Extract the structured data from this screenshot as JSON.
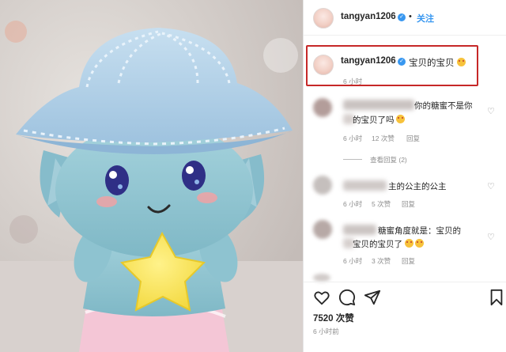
{
  "post": {
    "username": "tangyan1206",
    "verified_glyph": "✓",
    "separator": "•",
    "follow_label": "关注",
    "caption": "宝贝的宝贝",
    "caption_time": "6 小时",
    "likes": "7520 次赞",
    "post_time": "6 小时前"
  },
  "comments": [
    {
      "text_line1": "你的糖蜜不是你",
      "text_line2": "的宝贝了吗",
      "time": "6 小时",
      "likes": "12 次赞",
      "reply": "回复"
    },
    {
      "text_line1": "主的公主的公主",
      "time": "6 小时",
      "likes": "5 次赞",
      "reply": "回复"
    },
    {
      "text_line1": "糖蜜角度就是：宝贝的",
      "text_line2": "宝贝的宝贝了",
      "time": "6 小时",
      "likes": "3 次赞",
      "reply": "回复"
    }
  ],
  "view_replies": "查看回复 (2)",
  "icons": {
    "heart": "heart-icon",
    "comment": "comment-icon",
    "share": "share-icon",
    "bookmark": "bookmark-icon"
  },
  "colors": {
    "link": "#3897f0",
    "highlight_border": "#c62828",
    "text": "#262626",
    "muted": "#8e8e8e"
  }
}
